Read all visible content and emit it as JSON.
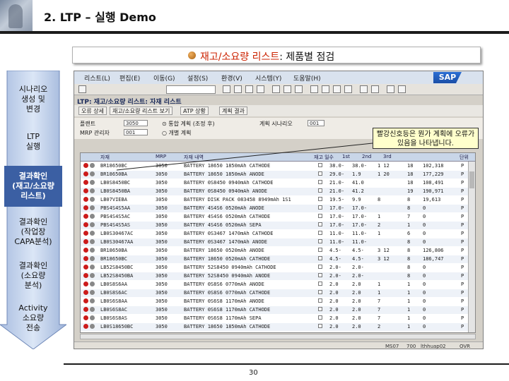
{
  "slide": {
    "title": "2. LTP – 실행 Demo",
    "banner_red": "재고/소요량 리스트",
    "banner_rest": ": 제품별 점검",
    "page_number": "30"
  },
  "process_steps": [
    {
      "label": "시나리오\n생성 및\n변경",
      "active": false
    },
    {
      "label": "LTP\n실행",
      "active": false
    },
    {
      "label": "결과확인\n(재고/소요량\n리스트)",
      "active": true
    },
    {
      "label": "결과확인\n(작업장\nCAPA분석)",
      "active": false
    },
    {
      "label": "결과확인\n(소요량\n분석)",
      "active": false
    },
    {
      "label": "Activity\n소요량\n전송",
      "active": false
    }
  ],
  "sap": {
    "logo": "SAP",
    "menu": [
      "리스트(L)",
      "편집(E)",
      "이동(G)",
      "설정(S)",
      "환경(V)",
      "시스템(Y)",
      "도움말(H)"
    ],
    "transaction_title": "LTP: 재고/소요량 리스트: 자재 리스트",
    "buttons": [
      "오류 상세",
      "재고/소요량 리스트 보기",
      "ATP 상황",
      "계획 결과"
    ],
    "params": {
      "plant_label": "플랜트",
      "plant_value": "3050",
      "mrp_controller_label": "MRP 관리자",
      "mrp_controller_value": "001",
      "scenario_label": "계획 시나리오",
      "scenario_value": "001",
      "opt1": "⊙ 통합 계획 (조정 후)",
      "opt2": "○ 개별 계획"
    },
    "callout": "빨강신호등은 뭔가 계획에 오류가 있음을 나타냅니다.",
    "columns": [
      "",
      "자재",
      "MRP",
      "자재 내역",
      "",
      "재고 일수",
      "1st",
      "2nd",
      "3rd",
      "",
      "",
      "",
      "단위"
    ],
    "rows": [
      {
        "light": "red",
        "material": "BR18650BC",
        "mrp": "3050",
        "desc": "BATTERY 18650 1850mAh CATHODE",
        "d1": "38.0-",
        "d2": "38.0-",
        "d3": "1 12",
        "n1": "18",
        "n2": "102,318",
        "unit": "P"
      },
      {
        "light": "red",
        "material": "BR18650BA",
        "mrp": "3050",
        "desc": "BATTERY 18650 1850mAh ANODE",
        "d1": "29.0-",
        "d2": "1.9",
        "d3": "1 20",
        "n1": "18",
        "n2": "177,229",
        "unit": "P"
      },
      {
        "light": "red",
        "material": "LB0S8450BC",
        "mrp": "3050",
        "desc": "BATTERY 0S8450 0940mAh CATHODE",
        "d1": "21.0-",
        "d2": "41.0",
        "d3": "",
        "n1": "18",
        "n2": "108,491",
        "unit": "P"
      },
      {
        "light": "red",
        "material": "LB0S8450BA",
        "mrp": "3050",
        "desc": "BATTERY 0S8450 0940mAh ANODE",
        "d1": "21.0-",
        "d2": "41.2",
        "d3": "",
        "n1": "19",
        "n2": "190,971",
        "unit": "P"
      },
      {
        "light": "red",
        "material": "LB07VIEBA",
        "mrp": "3050",
        "desc": "BATTERY DISK PACK 083458 8949mAh 1S1",
        "d1": "19.5-",
        "d2": "9.9",
        "d3": "8",
        "n1": "8",
        "n2": "19,613",
        "unit": "P"
      },
      {
        "light": "red",
        "material": "PBS4S4S5AA",
        "mrp": "3050",
        "desc": "BATTERY 4S4S6 0520mAh ANODE",
        "d1": "17.0-",
        "d2": "17.0-",
        "d3": "",
        "n1": "8",
        "n2": "0",
        "unit": "P"
      },
      {
        "light": "red",
        "material": "PBS4S4S5AC",
        "mrp": "3050",
        "desc": "BATTERY 4S4S6 0520mAh CATHODE",
        "d1": "17.0-",
        "d2": "17.0-",
        "d3": "1",
        "n1": "7",
        "n2": "0",
        "unit": "P"
      },
      {
        "light": "red",
        "material": "PBS4S4S5AS",
        "mrp": "3050",
        "desc": "BATTERY 4S4S6 0520mAh SEPA",
        "d1": "17.0-",
        "d2": "17.0-",
        "d3": "2",
        "n1": "1",
        "n2": "0",
        "unit": "P"
      },
      {
        "light": "red",
        "material": "LB0S30467AC",
        "mrp": "3050",
        "desc": "BATTERY 0S3467 1470mAh CATHODE",
        "d1": "11.0-",
        "d2": "11.0-",
        "d3": "1",
        "n1": "6",
        "n2": "0",
        "unit": "P"
      },
      {
        "light": "red",
        "material": "LB0S30467AA",
        "mrp": "3050",
        "desc": "BATTERY 0S3467 1470mAh ANODE",
        "d1": "11.0-",
        "d2": "11.0-",
        "d3": "",
        "n1": "8",
        "n2": "0",
        "unit": "P"
      },
      {
        "light": "red",
        "material": "BR18650BA",
        "mrp": "3050",
        "desc": "BATTERY 18650 0520mAh ANODE",
        "d1": "4.5-",
        "d2": "4.5-",
        "d3": "3 12",
        "n1": "8",
        "n2": "126,806",
        "unit": "P"
      },
      {
        "light": "red",
        "material": "BR18650BC",
        "mrp": "3050",
        "desc": "BATTERY 18650 0520mAh CATHODE",
        "d1": "4.5-",
        "d2": "4.5-",
        "d3": "3 12",
        "n1": "8",
        "n2": "186,747",
        "unit": "P"
      },
      {
        "light": "red",
        "material": "LB52S8450BC",
        "mrp": "3050",
        "desc": "BATTERY 52S8450 0940mAh CATHODE",
        "d1": "2.0-",
        "d2": "2.0-",
        "d3": "",
        "n1": "8",
        "n2": "0",
        "unit": "P"
      },
      {
        "light": "red",
        "material": "LB52S8450BA",
        "mrp": "3050",
        "desc": "BATTERY 52S8450 0940mAh ANODE",
        "d1": "2.0-",
        "d2": "2.0-",
        "d3": "",
        "n1": "8",
        "n2": "0",
        "unit": "P"
      },
      {
        "light": "red",
        "material": "LB0S8S6AA",
        "mrp": "3050",
        "desc": "BATTERY 0S8S6 0770mAh ANODE",
        "d1": "2.0",
        "d2": "2.0",
        "d3": "1",
        "n1": "1",
        "n2": "0",
        "unit": "P"
      },
      {
        "light": "red",
        "material": "LB0S8S6AC",
        "mrp": "3050",
        "desc": "BATTERY 0S8S6 0770mAh CATHODE",
        "d1": "2.0",
        "d2": "2.0",
        "d3": "1",
        "n1": "1",
        "n2": "0",
        "unit": "P"
      },
      {
        "light": "red",
        "material": "LB0S6S8AA",
        "mrp": "3050",
        "desc": "BATTERY 0S6S8 1170mAh ANODE",
        "d1": "2.0",
        "d2": "2.0",
        "d3": "7",
        "n1": "1",
        "n2": "0",
        "unit": "P"
      },
      {
        "light": "red",
        "material": "LB0S6S8AC",
        "mrp": "3050",
        "desc": "BATTERY 0S6S8 1170mAh CATHODE",
        "d1": "2.0",
        "d2": "2.0",
        "d3": "7",
        "n1": "1",
        "n2": "0",
        "unit": "P"
      },
      {
        "light": "red",
        "material": "LB0S6S8AS",
        "mrp": "3050",
        "desc": "BATTERY 0S6S8 1170mAh SEPA",
        "d1": "2.0",
        "d2": "2.0",
        "d3": "7",
        "n1": "1",
        "n2": "0",
        "unit": "P"
      },
      {
        "light": "red",
        "material": "LB0S18650BC",
        "mrp": "3050",
        "desc": "BATTERY 18650 1850mAh CATHODE",
        "d1": "2.0",
        "d2": "2.0",
        "d3": "2",
        "n1": "1",
        "n2": "0",
        "unit": "P"
      }
    ],
    "status": {
      "left": "",
      "server": "MS07",
      "client": "700",
      "user": "lthhuap02",
      "mode": "OVR"
    }
  },
  "colors": {
    "red_light": "#cc1b1b",
    "yellow_light": "#e8c31b",
    "process_arrow": "#5b7ab0",
    "process_active": "#2e4f8f"
  }
}
